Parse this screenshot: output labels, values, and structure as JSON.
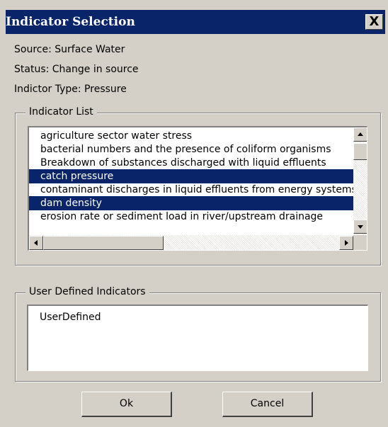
{
  "window": {
    "title": "Indicator Selection",
    "close_symbol": "X",
    "close_icon": "close-x-icon"
  },
  "info": {
    "source": "Source: Surface Water",
    "status": "Status: Change in source",
    "type": "Indictor Type: Pressure"
  },
  "indicator_list": {
    "label": "Indicator List",
    "items": [
      {
        "label": "agriculture sector water stress",
        "selected": false
      },
      {
        "label": "bacterial numbers and the presence of coliform organisms",
        "selected": false
      },
      {
        "label": "Breakdown of substances discharged with liquid effluents",
        "selected": false
      },
      {
        "label": "catch pressure",
        "selected": true
      },
      {
        "label": "contaminant discharges in liquid effluents from energy systems",
        "selected": false
      },
      {
        "label": "dam density",
        "selected": true
      },
      {
        "label": "erosion rate or sediment load in river/upstream drainage",
        "selected": false
      }
    ],
    "scroll_icons": [
      "arrow-up-icon",
      "arrow-down-icon",
      "arrow-left-icon",
      "arrow-right-icon"
    ]
  },
  "user_defined": {
    "label": "User Defined Indicators",
    "items": [
      "UserDefined"
    ]
  },
  "buttons": {
    "ok": "Ok",
    "cancel": "Cancel"
  }
}
